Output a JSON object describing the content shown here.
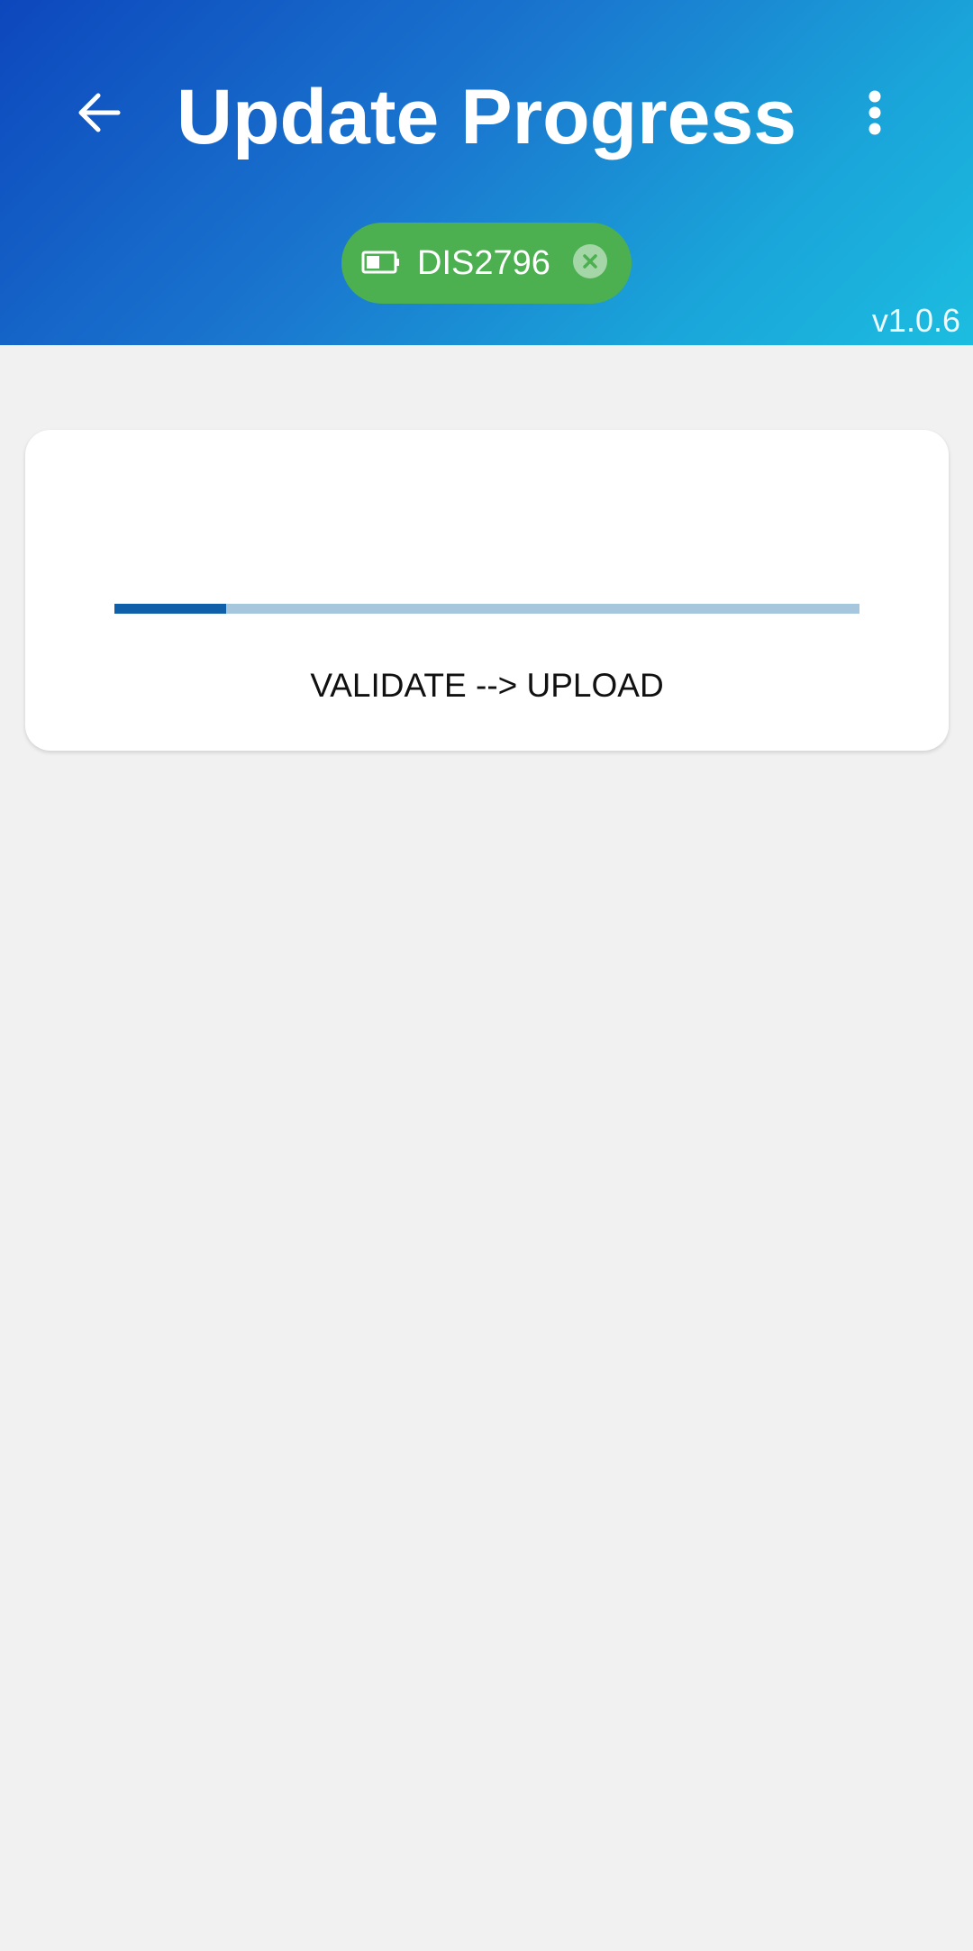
{
  "header": {
    "title": "Update Progress",
    "back_icon": "arrow-back-icon",
    "menu_icon": "more-vert-icon",
    "version": "v1.0.6",
    "gradient_colors": [
      "#0d47bd",
      "#1a78cf",
      "#1cbde0"
    ]
  },
  "device_chip": {
    "label": "DIS2796",
    "status_icon": "battery-icon",
    "close_icon": "close-circle-icon",
    "color": "#4caf50"
  },
  "progress_card": {
    "progress_fraction": 0.15,
    "bar_color": "#0f5fa9",
    "track_color": "#a6c6de",
    "status_text": "VALIDATE --> UPLOAD"
  }
}
